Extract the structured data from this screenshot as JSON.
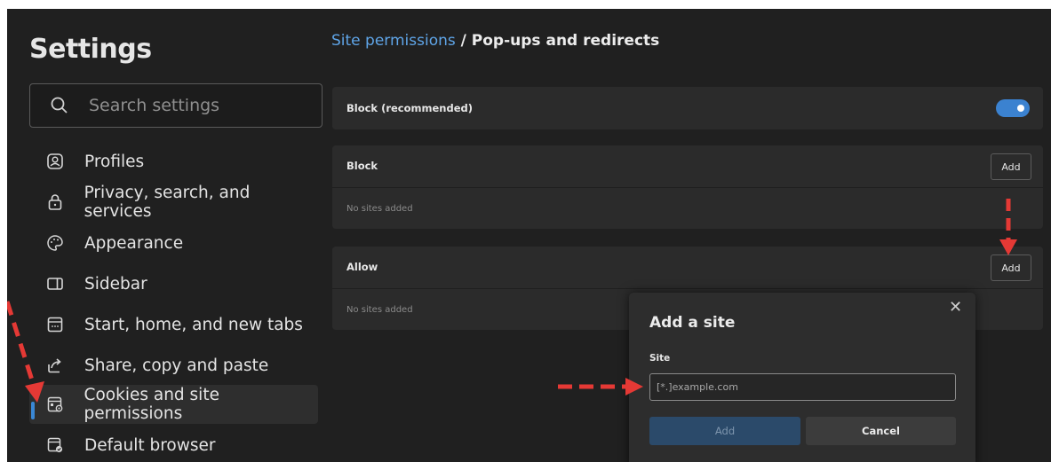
{
  "sidebar": {
    "title": "Settings",
    "search_placeholder": "Search settings",
    "items": [
      {
        "label": "Profiles",
        "icon": "profile-icon"
      },
      {
        "label": "Privacy, search, and services",
        "icon": "lock-icon"
      },
      {
        "label": "Appearance",
        "icon": "palette-icon"
      },
      {
        "label": "Sidebar",
        "icon": "sidebar-icon"
      },
      {
        "label": "Start, home, and new tabs",
        "icon": "new-tab-icon"
      },
      {
        "label": "Share, copy and paste",
        "icon": "share-icon"
      },
      {
        "label": "Cookies and site permissions",
        "icon": "cookies-icon",
        "active": true
      },
      {
        "label": "Default browser",
        "icon": "default-browser-icon"
      }
    ]
  },
  "breadcrumb": {
    "parent": "Site permissions",
    "separator": " / ",
    "current": "Pop-ups and redirects"
  },
  "block_recommended": {
    "label": "Block (recommended)",
    "enabled": true
  },
  "block_section": {
    "label": "Block",
    "add_label": "Add",
    "empty_text": "No sites added"
  },
  "allow_section": {
    "label": "Allow",
    "add_label": "Add",
    "empty_text": "No sites added"
  },
  "dialog": {
    "title": "Add a site",
    "close": "✕",
    "field_label": "Site",
    "placeholder": "[*.]example.com",
    "add_label": "Add",
    "cancel_label": "Cancel"
  },
  "colors": {
    "accent": "#3b82d0",
    "annotation_arrow": "#e53935"
  }
}
